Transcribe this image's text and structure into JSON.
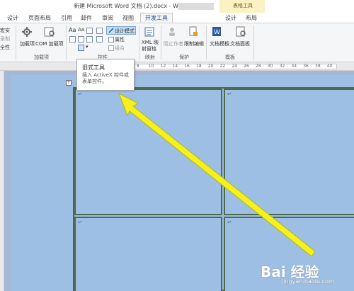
{
  "window": {
    "title": "新建 Microsoft Word 文档 (2).docx - Word",
    "context_title": "表格工具"
  },
  "tabs": [
    "设计",
    "页面布局",
    "引用",
    "邮件",
    "审阅",
    "视图",
    "开发工具"
  ],
  "context_tabs": [
    "设计",
    "布局"
  ],
  "ribbon": {
    "code_group": {
      "items": [
        "宏安",
        "录制",
        "全性"
      ]
    },
    "addins_group": {
      "label": "加载项",
      "addins": "加载项",
      "com": "COM 加载项"
    },
    "controls_group": {
      "label": "控件",
      "design_mode": "设计模式",
      "properties": "属性",
      "group": "组合"
    },
    "mapping_group": {
      "label": "映射",
      "xml": "XML 映",
      "xml2": "射窗格"
    },
    "protect_group": {
      "label": "保护",
      "block": "阻止作者",
      "restrict": "限制编辑"
    },
    "templates_group": {
      "label": "模板",
      "doc_template": "文档模板",
      "doc_panel": "文档面板"
    }
  },
  "ruler": {
    "numbers": [
      "8",
      "10",
      "12",
      "14",
      "16",
      "18",
      "20",
      "22",
      "24",
      "26",
      "28",
      "30",
      "32",
      "34",
      "36",
      "38",
      "40"
    ]
  },
  "tooltip": {
    "title": "旧式工具",
    "desc": "插入 ActiveX 控件或表单控件。"
  },
  "table": {
    "cell_mark": "↵"
  },
  "watermark": {
    "brand": "Bai 经验",
    "url": "jingyan.baidu.com"
  },
  "colors": {
    "page": "#9dbfe4",
    "table_border": "#4d6a4d",
    "arrow": "#f5f11e",
    "active_tab": "#1f4e8c"
  }
}
